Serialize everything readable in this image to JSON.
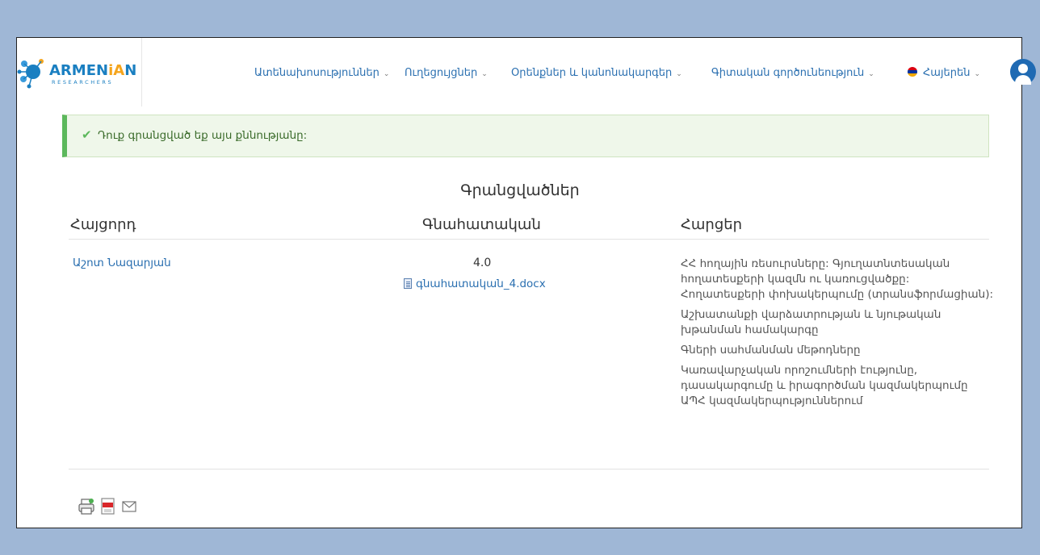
{
  "brand": {
    "logo_main_pre": "ARMEN",
    "logo_main_ia": "iA",
    "logo_main_post": "N",
    "logo_sub": "RESEARCHERS"
  },
  "nav": {
    "items": [
      {
        "label": "Ատենախոսություններ",
        "icon": "chevron-down-icon"
      },
      {
        "label": "Ուղեցույցներ",
        "icon": "chevron-down-icon"
      },
      {
        "label": "Օրենքներ և կանոնակարգեր",
        "icon": "chevron-down-icon"
      },
      {
        "label": "Գիտական գործունեություն",
        "icon": "chevron-down-icon"
      },
      {
        "label": "Հայերեն",
        "icon": "chevron-down-icon"
      }
    ],
    "language_flag": "armenian-flag-icon",
    "user_icon": "user-avatar-icon"
  },
  "alert": {
    "text": "Դուք գրանցված եք այս քննությանը:",
    "icon": "check-icon",
    "accent": "#5cb85c"
  },
  "registrations": {
    "title": "Գրանցվածներ",
    "columns": [
      "Հայցորդ",
      "Գնահատական",
      "Հարցեր"
    ],
    "rows": [
      {
        "applicant": "Աշոտ Նազարյան",
        "score": "4.0",
        "file": "գնահատական_4.docx",
        "questions": [
          "ՀՀ հողային ռեսուրսները: Գյուղատնտեսական հողատեսքերի կազմն ու կառուցվածքը: Հողատեսքերի փոխակերպումը (տրանսֆորմացիան):",
          "Աշխատանքի վարձատրության և նյութական խթանման համակարգը",
          "Գների սահմանման մեթոդները",
          "Կառավարչական որոշումների էությունը, դասակարգումը և իրագործման կազմակերպումը ԱՊՀ կազմակերպություններում"
        ]
      }
    ]
  },
  "tools": [
    {
      "icon": "print-icon"
    },
    {
      "icon": "pdf-icon"
    },
    {
      "icon": "email-icon"
    }
  ],
  "colors": {
    "link": "#2a6fb0",
    "background": "#9fb7d6",
    "alert_bg": "#eff7ea"
  }
}
